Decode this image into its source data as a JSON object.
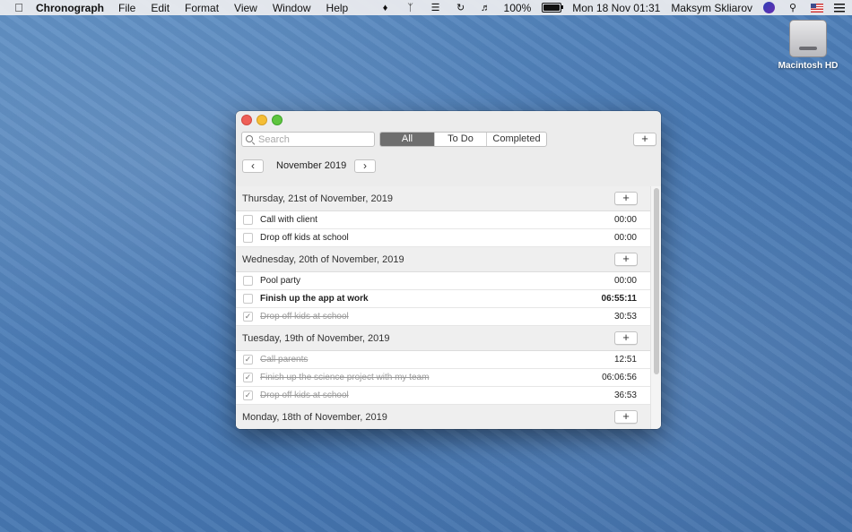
{
  "menubar": {
    "app_name": "Chronograph",
    "menus": [
      "File",
      "Edit",
      "Format",
      "View",
      "Window",
      "Help"
    ],
    "battery_text": "100%",
    "battery_level": 1.0,
    "clock": "Mon 18 Nov  01:31",
    "user": "Maksym Skliarov",
    "icons": [
      "apple-icon",
      "evernote-icon",
      "bluetooth-icon",
      "wifi-icon",
      "time-machine-icon",
      "volume-icon",
      "battery-icon",
      "siri-icon",
      "search-icon",
      "flag-icon",
      "notification-center-icon"
    ]
  },
  "desktop": {
    "icon_label": "Macintosh HD"
  },
  "window": {
    "search_placeholder": "Search",
    "filters": [
      {
        "label": "All",
        "active": true
      },
      {
        "label": "To Do",
        "active": false
      },
      {
        "label": "Completed",
        "active": false
      }
    ],
    "add_label": "+",
    "prev_label": "‹",
    "next_label": "›",
    "month": "November 2019",
    "days": [
      {
        "title": "Thursday, 21st of November, 2019",
        "tasks": [
          {
            "title": "Call with client",
            "time": "00:00",
            "done": false,
            "running": false
          },
          {
            "title": "Drop off kids at school",
            "time": "00:00",
            "done": false,
            "running": false
          }
        ]
      },
      {
        "title": "Wednesday, 20th of November, 2019",
        "tasks": [
          {
            "title": "Pool party",
            "time": "00:00",
            "done": false,
            "running": false
          },
          {
            "title": "Finish up the app at work",
            "time": "06:55:11",
            "done": false,
            "running": true
          },
          {
            "title": "Drop off kids at school",
            "time": "30:53",
            "done": true,
            "running": false
          }
        ]
      },
      {
        "title": "Tuesday, 19th of November, 2019",
        "tasks": [
          {
            "title": "Call parents",
            "time": "12:51",
            "done": true,
            "running": false
          },
          {
            "title": "Finish up the science project with my team",
            "time": "06:06:56",
            "done": true,
            "running": false
          },
          {
            "title": "Drop off kids at school",
            "time": "36:53",
            "done": true,
            "running": false
          }
        ]
      },
      {
        "title": "Monday, 18th of November, 2019",
        "tasks": []
      }
    ]
  }
}
